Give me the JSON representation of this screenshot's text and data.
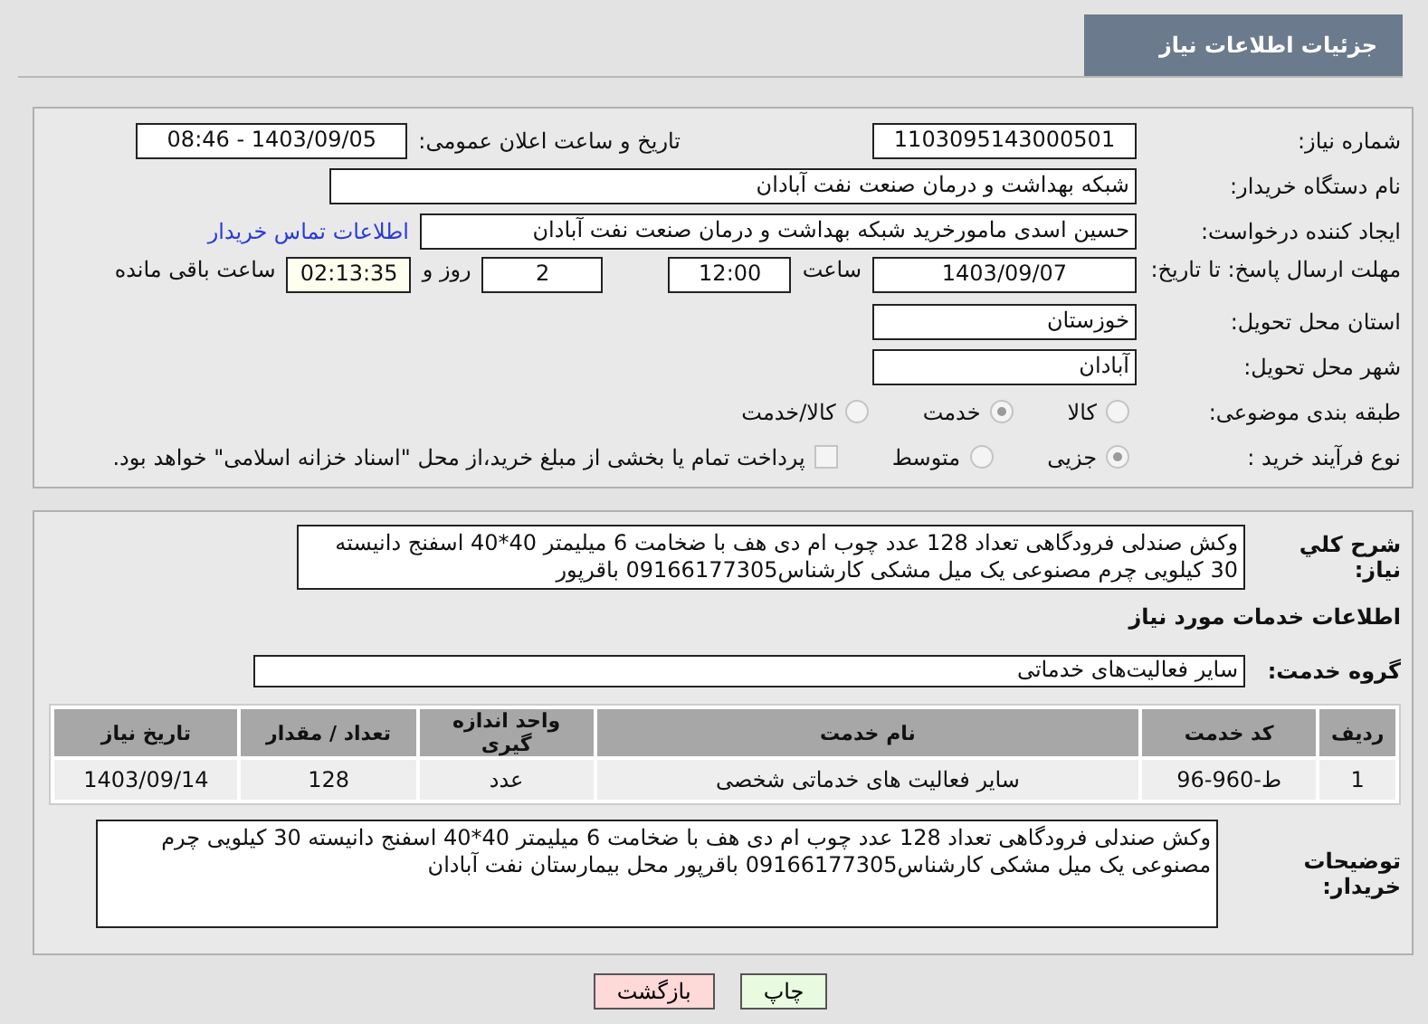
{
  "header": {
    "title": "جزئیات اطلاعات نیاز"
  },
  "need_number": {
    "label": "شماره نیاز:",
    "value": "1103095143000501"
  },
  "announce": {
    "label": "تاریخ و ساعت اعلان عمومی:",
    "value": "1403/09/05 - 08:46"
  },
  "buyer_org": {
    "label": "نام دستگاه خریدار:",
    "value": "شبکه بهداشت و درمان صنعت نفت آبادان"
  },
  "requester": {
    "label": "ایجاد کننده درخواست:",
    "value": "حسین اسدی مامورخرید شبکه بهداشت و درمان صنعت نفت آبادان",
    "link": "اطلاعات تماس خریدار"
  },
  "deadline": {
    "label": "مهلت ارسال پاسخ: تا تاریخ:",
    "date": "1403/09/07",
    "time_label": "ساعت",
    "time": "12:00",
    "days": "2",
    "days_label": "روز و",
    "remaining": "02:13:35",
    "remaining_label": "ساعت باقی مانده"
  },
  "province": {
    "label": "استان محل تحویل:",
    "value": "خوزستان"
  },
  "city": {
    "label": "شهر محل تحویل:",
    "value": "آبادان"
  },
  "category": {
    "label": "طبقه بندی موضوعی:",
    "options": [
      {
        "label": "کالا",
        "selected": false
      },
      {
        "label": "خدمت",
        "selected": true
      },
      {
        "label": "کالا/خدمت",
        "selected": false
      }
    ]
  },
  "process": {
    "label": "نوع فرآیند خرید :",
    "options": [
      {
        "label": "جزیی",
        "selected": true
      },
      {
        "label": "متوسط",
        "selected": false
      }
    ],
    "treasury": {
      "checked": false,
      "label": "پرداخت تمام یا بخشی از مبلغ خرید،از محل \"اسناد خزانه اسلامی\" خواهد بود."
    }
  },
  "description": {
    "label": "شرح کلي نياز:",
    "value": "وکش صندلی فرودگاهی تعداد 128 عدد چوب ام دی هف با ضخامت 6 میلیمتر 40*40 اسفنج دانیسته 30 کیلویی چرم مصنوعی یک میل مشکی کارشناس09166177305 باقرپور"
  },
  "services_title": "اطلاعات خدمات مورد نیاز",
  "service_group": {
    "label": "گروه خدمت:",
    "value": "سایر فعالیت‌های خدماتی"
  },
  "table": {
    "columns": [
      "ردیف",
      "کد خدمت",
      "نام خدمت",
      "واحد اندازه گیری",
      "تعداد / مقدار",
      "تاریخ نیاز"
    ],
    "rows": [
      [
        "1",
        "ط-960-96",
        "سایر فعالیت های خدماتی شخصی",
        "عدد",
        "128",
        "1403/09/14"
      ]
    ]
  },
  "buyer_notes": {
    "label": "توضیحات خریدار:",
    "value": "وکش صندلی فرودگاهی تعداد 128 عدد چوب ام دی هف با ضخامت 6 میلیمتر 40*40 اسفنج دانیسته 30 کیلویی چرم مصنوعی یک میل مشکی کارشناس09166177305 باقرپور محل بیمارستان نفت آبادان"
  },
  "buttons": [
    {
      "label": "چاپ",
      "kind": "print"
    },
    {
      "label": "بازگشت",
      "kind": "back"
    }
  ]
}
